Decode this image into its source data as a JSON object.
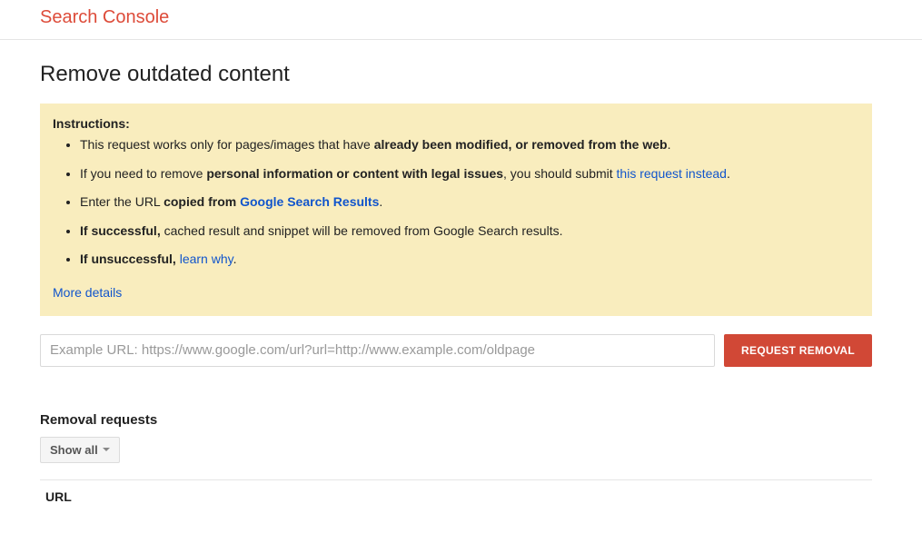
{
  "header": {
    "logo": "Search Console"
  },
  "page": {
    "title": "Remove outdated content"
  },
  "instructions": {
    "title": "Instructions:",
    "line1_a": "This request works only for pages/images that have ",
    "line1_b": "already been modified, or removed from the web",
    "line1_c": ".",
    "line2_a": "If you need to remove ",
    "line2_b": "personal information or content with legal issues",
    "line2_c": ", you should submit ",
    "line2_link": "this request instead",
    "line2_d": ".",
    "line3_a": "Enter the URL ",
    "line3_b": "copied from ",
    "line3_link": "Google Search Results",
    "line3_c": ".",
    "line4_a": "If successful,",
    "line4_b": " cached result and snippet will be removed from Google Search results.",
    "line5_a": "If unsuccessful, ",
    "line5_link": "learn why",
    "line5_b": ".",
    "more_details": "More details"
  },
  "form": {
    "url_placeholder": "Example URL: https://www.google.com/url?url=http://www.example.com/oldpage",
    "request_button": "REQUEST REMOVAL"
  },
  "requests": {
    "section_title": "Removal requests",
    "filter_label": "Show all",
    "table_header_url": "URL"
  }
}
